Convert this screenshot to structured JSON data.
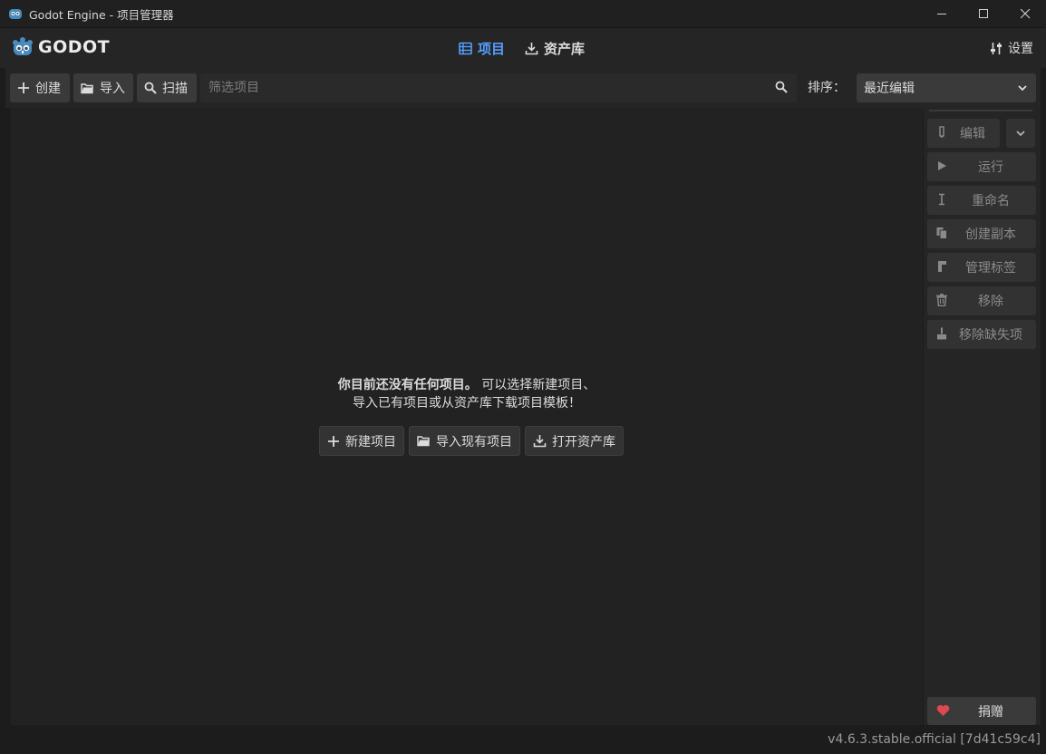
{
  "window": {
    "title": "Godot Engine - 项目管理器",
    "minimize_icon": "minimize-icon",
    "maximize_icon": "maximize-icon",
    "close_icon": "close-icon"
  },
  "header": {
    "logo_text": "GODOT",
    "tabs": [
      {
        "label": "项目",
        "icon": "project-list-icon",
        "active": true
      },
      {
        "label": "资产库",
        "icon": "download-icon",
        "active": false
      }
    ],
    "settings_label": "设置",
    "accent_color": "#569eff"
  },
  "toolbar": {
    "create_label": "创建",
    "import_label": "导入",
    "scan_label": "扫描",
    "search_placeholder": "筛选项目",
    "sort_label": "排序：",
    "sort_value": "最近编辑"
  },
  "empty_state": {
    "bold_text": "你目前还没有任何项目。",
    "line1_rest": "可以选择新建项目、",
    "line2": "导入已有项目或从资产库下载项目模板！",
    "new_project_label": "新建项目",
    "import_existing_label": "导入现有项目",
    "open_assetlib_label": "打开资产库"
  },
  "sidebar": {
    "edit_label": "编辑",
    "run_label": "运行",
    "rename_label": "重命名",
    "duplicate_label": "创建副本",
    "manage_tags_label": "管理标签",
    "remove_label": "移除",
    "remove_missing_label": "移除缺失项",
    "donate_label": "捐赠",
    "donate_color": "#e0484f"
  },
  "version": "v4.6.3.stable.official [7d41c59c4]"
}
